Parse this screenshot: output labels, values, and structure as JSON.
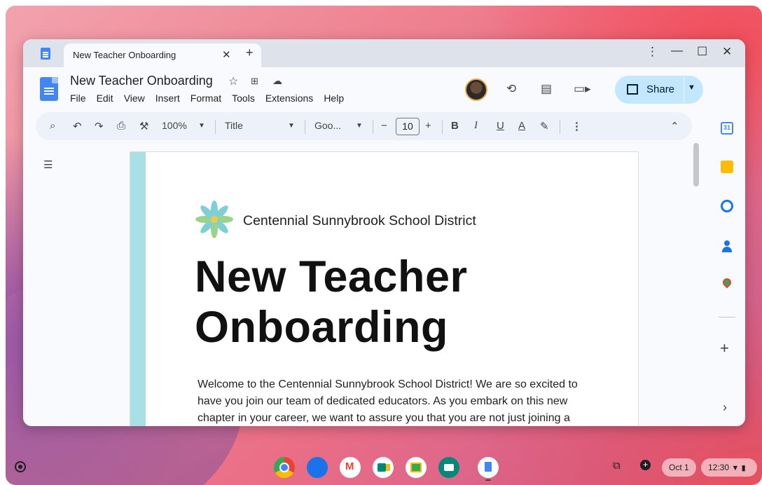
{
  "browser": {
    "tab_title": "New Teacher Onboarding",
    "tab_close": "✕",
    "new_tab": "+",
    "menu_icon": "⋮",
    "minimize": "—",
    "maximize": "☐",
    "close": "✕"
  },
  "doc": {
    "title": "New Teacher Onboarding",
    "menu": [
      "File",
      "Edit",
      "View",
      "Insert",
      "Format",
      "Tools",
      "Extensions",
      "Help"
    ],
    "share_label": "Share"
  },
  "toolbar": {
    "zoom": "100%",
    "style": "Title",
    "font": "Goo...",
    "font_size": "10"
  },
  "page": {
    "district": "Centennial Sunnybrook School District",
    "title_line1": "New Teacher",
    "title_line2": "Onboarding",
    "body": "Welcome to the Centennial Sunnybrook School District! We are so excited to have you join our team of dedicated educators. As you embark on this new chapter in your career, we want to assure you that you are not just joining a"
  },
  "shelf": {
    "date": "Oct 1",
    "time": "12:30"
  },
  "sidebar": {
    "calendar_day": "31"
  },
  "colors": {
    "accent": "#c2e7ff",
    "docs_blue": "#4285f4",
    "page_band": "#a8e0e5"
  }
}
